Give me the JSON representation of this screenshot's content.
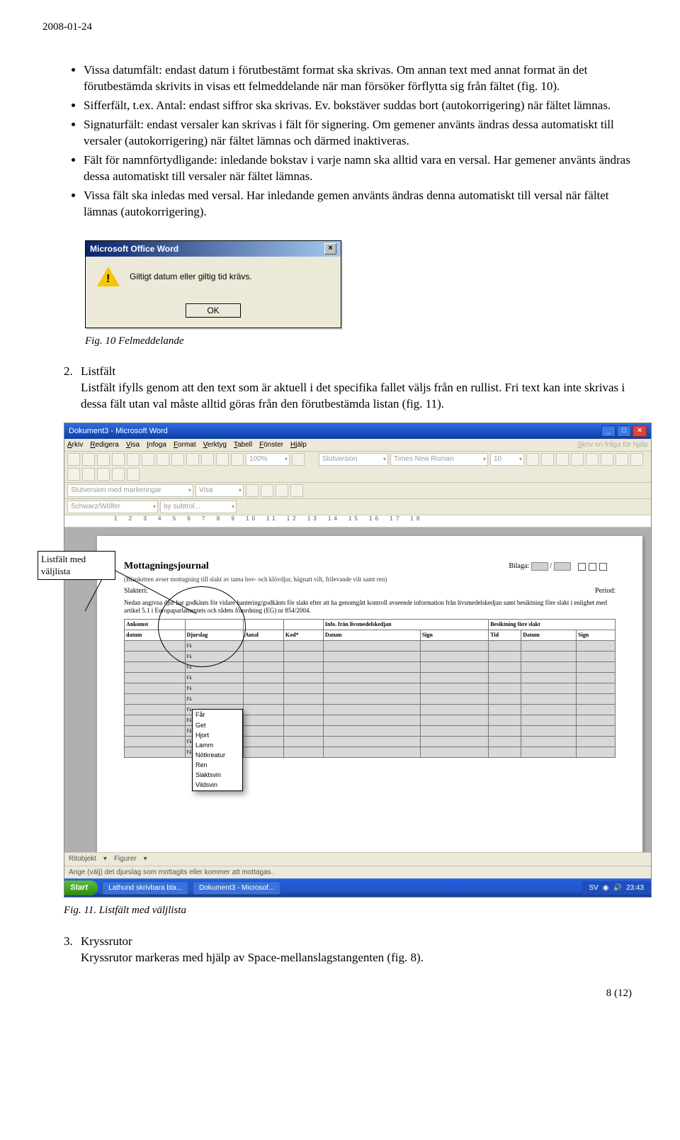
{
  "header": {
    "date": "2008-01-24"
  },
  "bullets": [
    "Vissa datumfält: endast datum i förutbestämt format ska skrivas. Om annan text med annat format än det förutbestämda skrivits in visas ett felmeddelande när man försöker förflytta sig från fältet (fig. 10).",
    "Sifferfält, t.ex. Antal: endast siffror ska skrivas. Ev. bokstäver suddas bort (autokorrigering) när fältet lämnas.",
    "Signaturfält: endast versaler kan skrivas i fält för signering. Om gemener använts ändras dessa automatiskt till versaler (autokorrigering) när fältet lämnas och därmed inaktiveras.",
    "Fält för namnförtydligande: inledande bokstav i varje namn ska alltid vara en versal. Har gemener använts ändras dessa automatiskt till versaler när fältet lämnas.",
    "Vissa fält ska inledas med versal. Har inledande gemen använts ändras denna automatiskt till versal när fältet lämnas (autokorrigering)."
  ],
  "dialog": {
    "title": "Microsoft Office Word",
    "msg": "Giltigt datum eller giltig tid krävs.",
    "ok": "OK"
  },
  "fig10": "Fig. 10 Felmeddelande",
  "section2": {
    "num": "2.",
    "title": "Listfält",
    "body": "Listfält ifylls genom att den text som är aktuell i det specifika fallet väljs från en rullist. Fri text kan inte skrivas i dessa fält utan val måste alltid göras från den förutbestämda listan (fig. 11)."
  },
  "word": {
    "title_left": "Dokument3 - Microsoft Word",
    "menu": [
      "Arkiv",
      "Redigera",
      "Visa",
      "Infoga",
      "Format",
      "Verktyg",
      "Tabell",
      "Fönster",
      "Hjälp"
    ],
    "help_hint": "Skriv en fråga för hjälp",
    "sel_style": "Slutversion",
    "sel_font": "Times New Roman",
    "sel_size": "10",
    "sel_zoom": "100%",
    "sel2a": "Slutversion med markeringar",
    "sel2b": "Visa",
    "sel2c": "Schwarz/Wölfer",
    "sel2d": "by subtrol...",
    "ruler": "1 2 3 4 5 6 7 8 9 10 11 12 13 14 15 16 17 18",
    "doc": {
      "h": "Mottagningsjournal",
      "sub": "(Blanketten avser mottagning till slakt av tama hov- och klövdjur, hägnatt vilt, frilevande vilt samt ren)",
      "bilaga": "Bilaga:",
      "slakteri": "Slakteri:",
      "period": "Period:",
      "note": "Nedan angivna djur har godkänts för vidare hantering/godkänts för slakt efter att ha genomgått kontroll avseende information från livsmedelskedjan samt besiktning före slakt i enlighet med artikel 5.1 i Europaparlamentets och rådets förordning (EG) nr 854/2004.",
      "head_groups": [
        "Ankomst",
        "",
        "",
        "",
        "Info. från livsmedelskedjan",
        "",
        "Besiktning före slakt",
        "",
        ""
      ],
      "headers": [
        "datum",
        "Djurslag",
        "Antal",
        "Kod*",
        "Datum",
        "Sign",
        "Tid",
        "Datum",
        "Sign"
      ],
      "fix": "Fä"
    },
    "status_a": "Ritobjekt",
    "status_b": "Figurer",
    "status_hint": "Ange (välj) det djurslag som mottagits eller kommer att mottagas.",
    "task1": "Lathund skrivbara bla...",
    "task2": "Dokument3 - Microsof...",
    "tray_lang": "SV",
    "tray_time": "23:43"
  },
  "callout": {
    "line1": "Listfält med",
    "line2": "väljlista"
  },
  "dropdown": [
    "Får",
    "Get",
    "Hjort",
    "Lamm",
    "Nötkreatur",
    "Ren",
    "Slaktsvin",
    "Vildsvin"
  ],
  "fig11": "Fig. 11. Listfält med väljlista",
  "section3": {
    "num": "3.",
    "title": "Kryssrutor",
    "body": "Kryssrutor markeras med hjälp av Space-mellanslagstangenten (fig. 8)."
  },
  "pagenum": "8 (12)"
}
